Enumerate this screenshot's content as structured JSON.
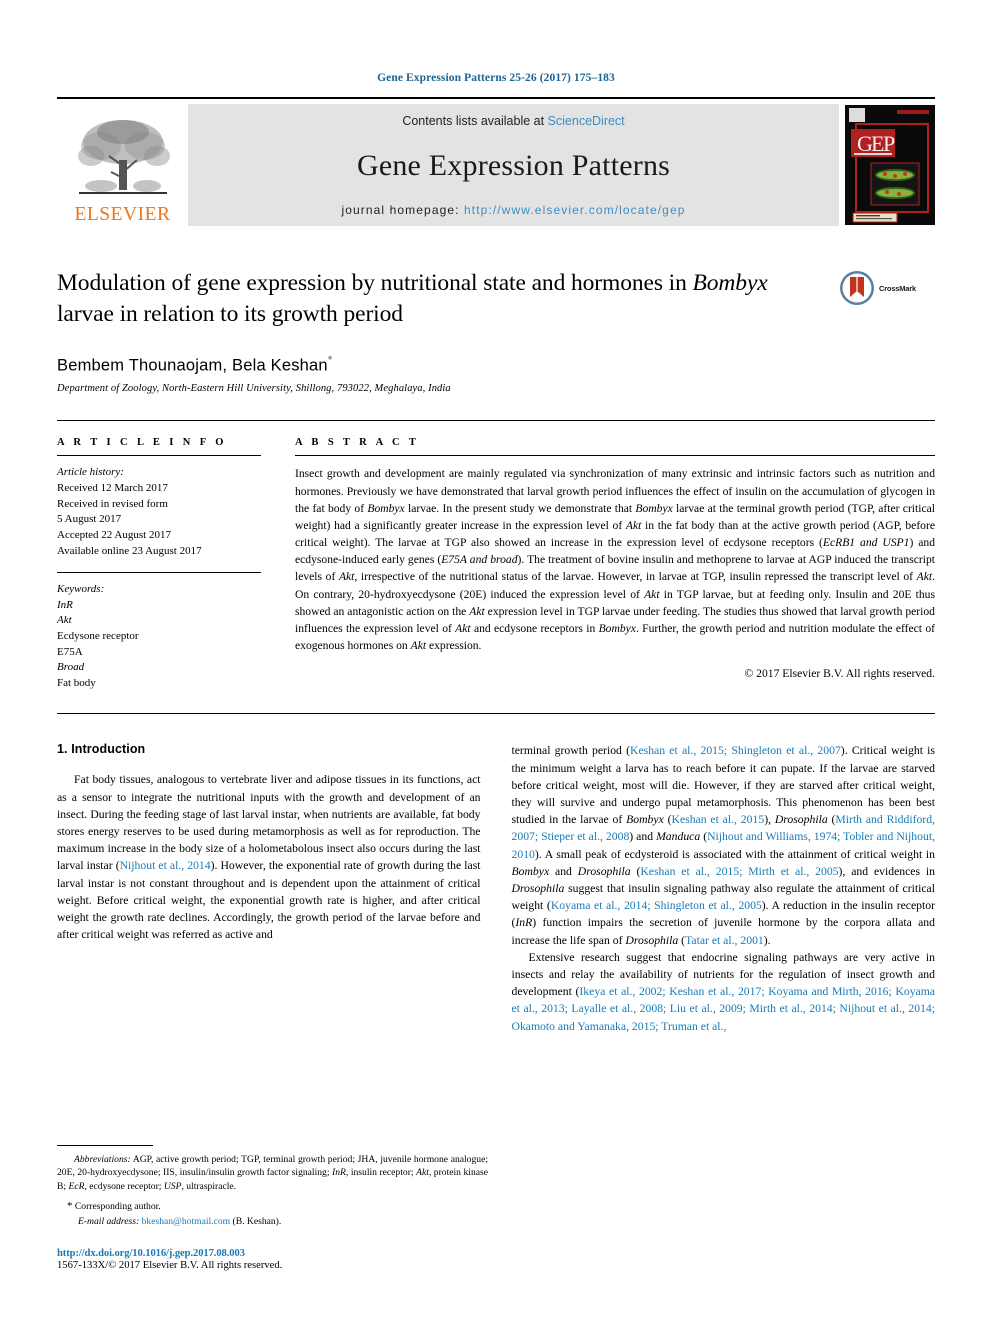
{
  "running_head": "Gene Expression Patterns 25-26 (2017) 175–183",
  "banner": {
    "publisher_logo_label": "ELSEVIER",
    "contents_prefix": "Contents lists available at ",
    "contents_link": "ScienceDirect",
    "journal_title": "Gene Expression Patterns",
    "homepage_prefix": "journal homepage: ",
    "homepage_url": "http://www.elsevier.com/locate/gep",
    "cover_thumb_label": "GEP journal cover"
  },
  "article": {
    "title_line1": "Modulation of gene expression by nutritional state and hormones in",
    "title_italic": "Bombyx",
    "title_line2_rest": " larvae in relation to its growth period",
    "authors": "Bembem Thounaojam, Bela Keshan",
    "author_star": "*",
    "affiliation": "Department of Zoology, North-Eastern Hill University, Shillong, 793022, Meghalaya, India",
    "crossmark_label": "CrossMark"
  },
  "article_info": {
    "heading": "A R T I C L E  I N F O",
    "history_label": "Article history:",
    "history": [
      "Received 12 March 2017",
      "Received in revised form",
      "5 August 2017",
      "Accepted 22 August 2017",
      "Available online 23 August 2017"
    ],
    "keywords_label": "Keywords:",
    "keywords": [
      "InR",
      "Akt",
      "Ecdysone receptor",
      "E75A",
      "Broad",
      "Fat body"
    ],
    "keywords_italic": [
      true,
      true,
      false,
      false,
      true,
      false
    ]
  },
  "abstract": {
    "heading": "A B S T R A C T",
    "paragraph_html": "Insect growth and development are mainly regulated via synchronization of many extrinsic and intrinsic factors such as nutrition and hormones. Previously we have demonstrated that larval growth period influences the effect of insulin on the accumulation of glycogen in the fat body of <i>Bombyx</i> larvae. In the present study we demonstrate that <i>Bombyx</i> larvae at the terminal growth period (TGP, after critical weight) had a significantly greater increase in the expression level of <i>Akt</i> in the fat body than at the active growth period (AGP, before critical weight). The larvae at TGP also showed an increase in the expression level of ecdysone receptors (<i>EcRB1 and USP1</i>) and ecdysone-induced early genes (<i>E75A and broad</i>). The treatment of bovine insulin and methoprene to larvae at AGP induced the transcript levels of <i>Akt</i>, irrespective of the nutritional status of the larvae. However, in larvae at TGP, insulin repressed the transcript level of <i>Akt</i>. On contrary, 20-hydroxyecdysone (20E) induced the expression level of <i>Akt</i> in TGP larvae, but at feeding only. Insulin and 20E thus showed an antagonistic action on the <i>Akt</i> expression level in TGP larvae under feeding. The studies thus showed that larval growth period influences the expression level of <i>Akt</i> and ecdysone receptors in <i>Bombyx</i>. Further, the growth period and nutrition modulate the effect of exogenous hormones on <i>Akt</i> expression.",
    "copyright": "© 2017 Elsevier B.V. All rights reserved."
  },
  "body": {
    "section_number_title": "1. Introduction",
    "left_paragraph_html": "Fat body tissues, analogous to vertebrate liver and adipose tissues in its functions, act as a sensor to integrate the nutritional inputs with the growth and development of an insect. During the feeding stage of last larval instar, when nutrients are available, fat body stores energy reserves to be used during metamorphosis as well as for reproduction. The maximum increase in the body size of a holometabolous insect also occurs during the last larval instar (<span class=\"ref\">Nijhout et al., 2014</span>). However, the exponential rate of growth during the last larval instar is not constant throughout and is dependent upon the attainment of critical weight. Before critical weight, the exponential growth rate is higher, and after critical weight the growth rate declines. Accordingly, the growth period of the larvae before and after critical weight was referred as active and",
    "right_paragraph1_html": "terminal growth period (<span class=\"ref\">Keshan et al., 2015; Shingleton et al., 2007</span>). Critical weight is the minimum weight a larva has to reach before it can pupate. If the larvae are starved before critical weight, most will die. However, if they are starved after critical weight, they will survive and undergo pupal metamorphosis. This phenomenon has been best studied in the larvae of <i>Bombyx</i> (<span class=\"ref\">Keshan et al., 2015</span>), <i>Drosophila</i> (<span class=\"ref\">Mirth and Riddiford, 2007; Stieper et al., 2008</span>) and <i>Manduca</i> (<span class=\"ref\">Nijhout and Williams, 1974; Tobler and Nijhout, 2010</span>). A small peak of ecdysteroid is associated with the attainment of critical weight in <i>Bombyx</i> and <i>Drosophila</i> (<span class=\"ref\">Keshan et al., 2015; Mirth et al., 2005</span>), and evidences in <i>Drosophila</i> suggest that insulin signaling pathway also regulate the attainment of critical weight (<span class=\"ref\">Koyama et al., 2014; Shingleton et al., 2005</span>). A reduction in the insulin receptor (<i>InR</i>) function impairs the secretion of juvenile hormone by the corpora allata and increase the life span of <i>Drosophila</i> (<span class=\"ref\">Tatar et al., 2001</span>).",
    "right_paragraph2_html": "Extensive research suggest that endocrine signaling pathways are very active in insects and relay the availability of nutrients for the regulation of insect growth and development (<span class=\"ref\">Ikeya et al., 2002; Keshan et al., 2017; Koyama and Mirth, 2016; Koyama et al., 2013; Layalle et al., 2008; Liu et al., 2009; Mirth et al., 2014; Nijhout et al., 2014; Okamoto and Yamanaka, 2015; Truman et al.,</span>"
  },
  "footnotes": {
    "abbreviations_html": "<i>Abbreviations:</i> AGP, active growth period; TGP, terminal growth period; JHA, juvenile hormone analogue; 20E, 20-hydroxyecdysone; IIS, insulin/insulin growth factor signaling; <i>InR</i>, insulin receptor; <i>Akt</i>, protein kinase B; <i>EcR</i>, ecdysone receptor; <i>USP</i>, ultraspiracle.",
    "corresponding_star": "*",
    "corresponding_text": "Corresponding author.",
    "email_label": "E-mail address:",
    "email": "bkeshan@hotmail.com",
    "email_suffix": "(B. Keshan).",
    "doi": "http://dx.doi.org/10.1016/j.gep.2017.08.003",
    "issn_line": "1567-133X/© 2017 Elsevier B.V. All rights reserved."
  },
  "colors": {
    "link_blue": "#1a7bb5",
    "elsevier_orange": "#E87722",
    "banner_grey": "#e3e3e3",
    "crossmark_red": "#c0341d"
  }
}
